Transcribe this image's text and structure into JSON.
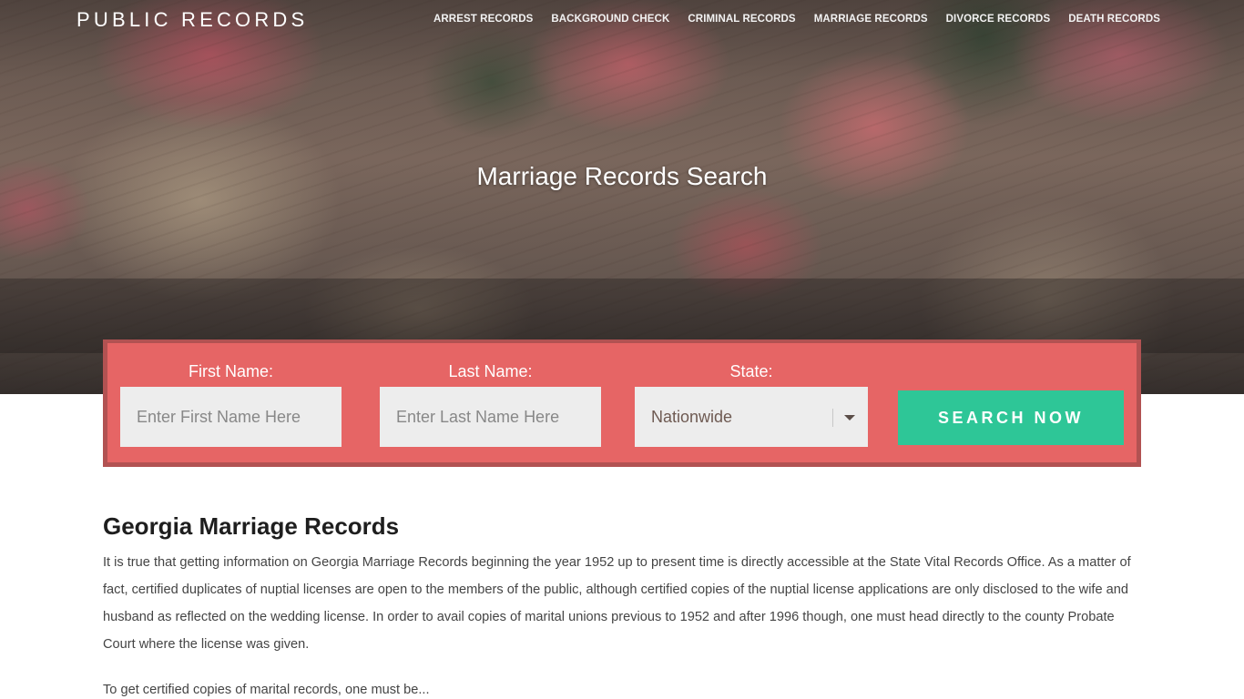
{
  "header": {
    "brand": "PUBLIC RECORDS",
    "nav": [
      {
        "label": "ARREST RECORDS"
      },
      {
        "label": "BACKGROUND CHECK"
      },
      {
        "label": "CRIMINAL RECORDS"
      },
      {
        "label": "MARRIAGE RECORDS"
      },
      {
        "label": "DIVORCE RECORDS"
      },
      {
        "label": "DEATH RECORDS"
      }
    ]
  },
  "hero": {
    "title": "Marriage Records Search"
  },
  "search": {
    "first_name": {
      "label": "First Name:",
      "placeholder": "Enter First Name Here",
      "value": ""
    },
    "last_name": {
      "label": "Last Name:",
      "placeholder": "Enter Last Name Here",
      "value": ""
    },
    "state": {
      "label": "State:",
      "selected": "Nationwide"
    },
    "button_label": "SEARCH NOW",
    "colors": {
      "panel": "#e66565",
      "panel_border": "#b25252",
      "button": "#2ec697",
      "input_bg": "#ededed"
    }
  },
  "article": {
    "heading": "Georgia Marriage Records",
    "paragraphs": [
      "It is true that getting information on Georgia Marriage Records beginning the year 1952 up to present time is directly accessible at the State Vital Records Office. As a matter of fact, certified duplicates of nuptial licenses are open to the members of the public, although certified copies of the nuptial license applications are only disclosed to the wife and husband as reflected on the wedding license. In order to avail copies of marital unions previous to 1952 and after 1996 though, one must head directly to the county Probate Court where the license was given.",
      "To get certified copies of marital records, one must be..."
    ]
  }
}
